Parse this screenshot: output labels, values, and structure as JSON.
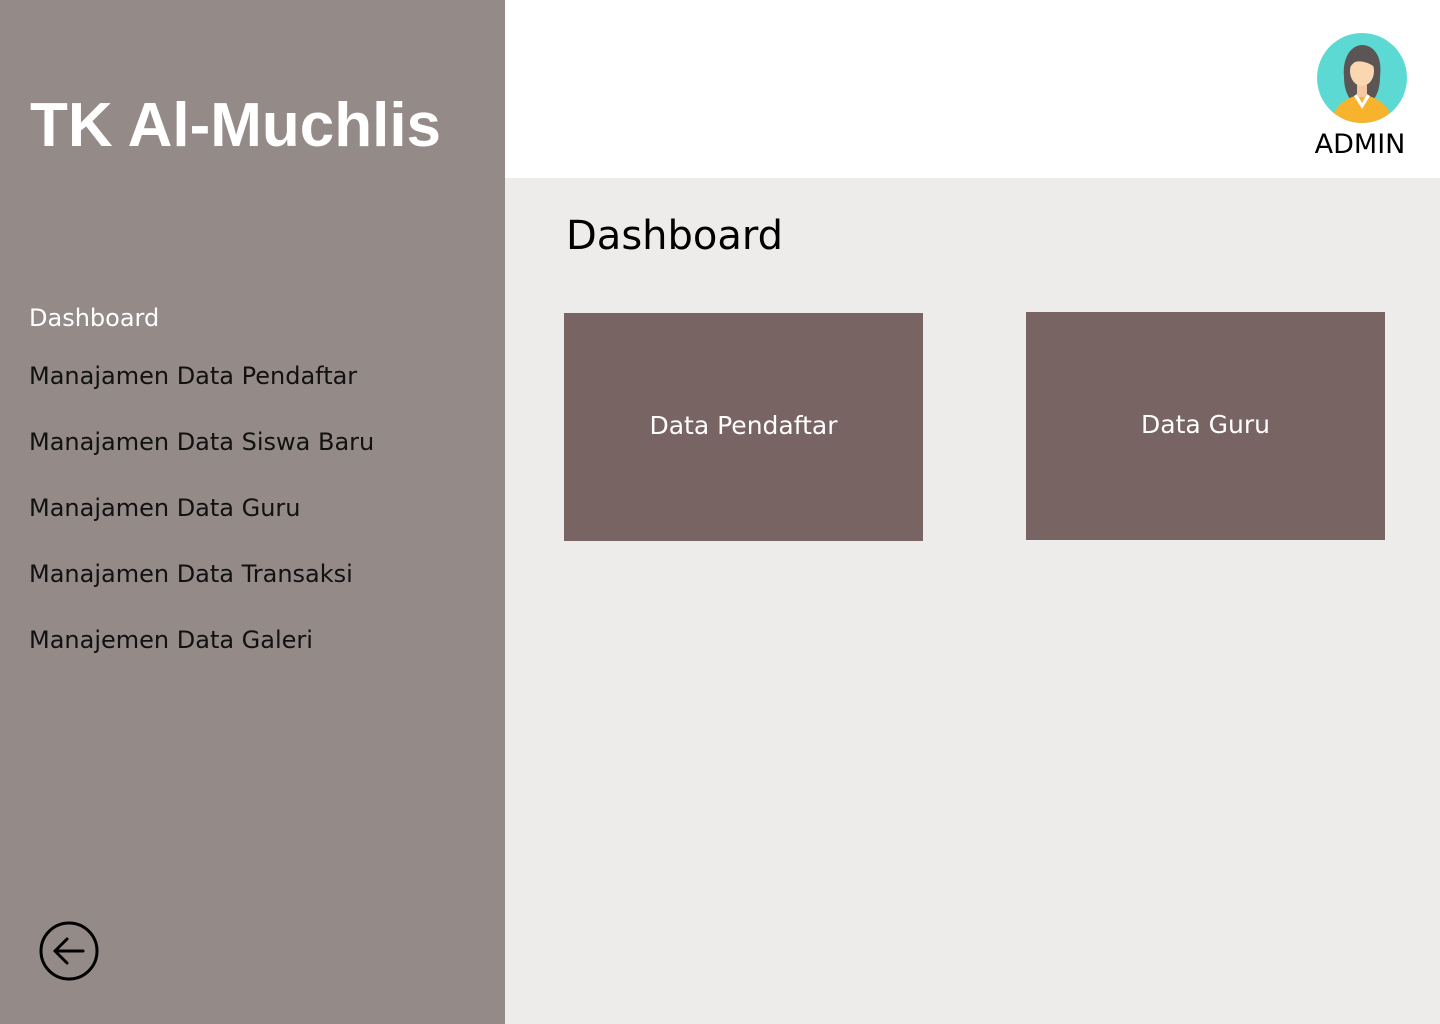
{
  "sidebar": {
    "brand": "TK Al-Muchlis",
    "items": [
      {
        "label": "Dashboard"
      },
      {
        "label": "Manajamen Data Pendaftar"
      },
      {
        "label": "Manajamen Data Siswa Baru"
      },
      {
        "label": "Manajamen Data Guru"
      },
      {
        "label": "Manajamen Data Transaksi"
      },
      {
        "label": "Manajemen Data Galeri"
      }
    ],
    "back_icon": "arrow-left-circle-icon"
  },
  "header": {
    "user_label": "ADMIN",
    "avatar_icon": "admin-avatar-icon"
  },
  "main": {
    "title": "Dashboard",
    "cards": [
      {
        "label": "Data Pendaftar"
      },
      {
        "label": "Data Guru"
      }
    ]
  },
  "colors": {
    "sidebar_bg": "#948a88",
    "card_bg": "#786462",
    "content_bg": "#eeecea",
    "header_bg": "#ffffff",
    "avatar_bg": "#5dd9d3"
  }
}
